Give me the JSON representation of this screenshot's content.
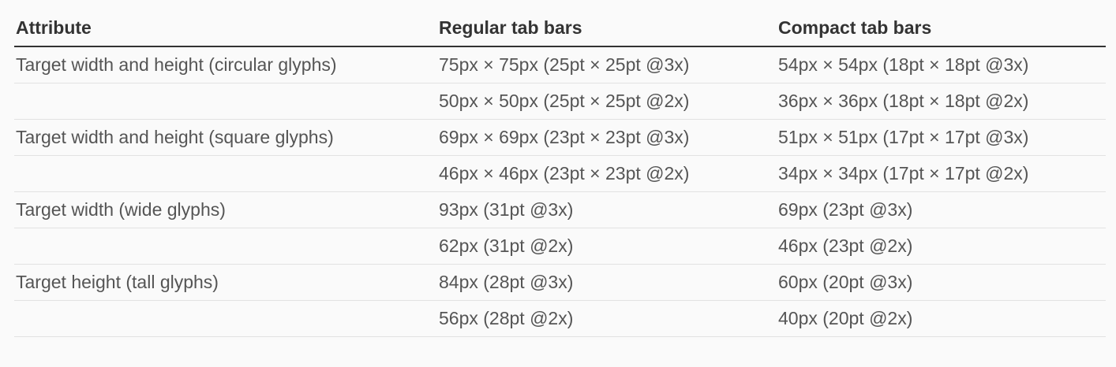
{
  "table": {
    "headers": [
      "Attribute",
      "Regular tab bars",
      "Compact tab bars"
    ],
    "rows": [
      [
        "Target width and height (circular glyphs)",
        "75px × 75px (25pt × 25pt @3x)",
        "54px × 54px (18pt × 18pt @3x)"
      ],
      [
        "",
        "50px × 50px (25pt × 25pt @2x)",
        "36px × 36px (18pt × 18pt @2x)"
      ],
      [
        "Target width and height (square glyphs)",
        "69px × 69px (23pt × 23pt @3x)",
        "51px × 51px (17pt × 17pt @3x)"
      ],
      [
        "",
        "46px × 46px (23pt × 23pt @2x)",
        "34px × 34px (17pt × 17pt @2x)"
      ],
      [
        "Target width (wide glyphs)",
        "93px (31pt @3x)",
        "69px (23pt @3x)"
      ],
      [
        "",
        "62px (31pt @2x)",
        "46px (23pt @2x)"
      ],
      [
        "Target height (tall glyphs)",
        "84px (28pt @3x)",
        "60px (20pt @3x)"
      ],
      [
        "",
        "56px (28pt @2x)",
        "40px (20pt @2x)"
      ]
    ]
  }
}
